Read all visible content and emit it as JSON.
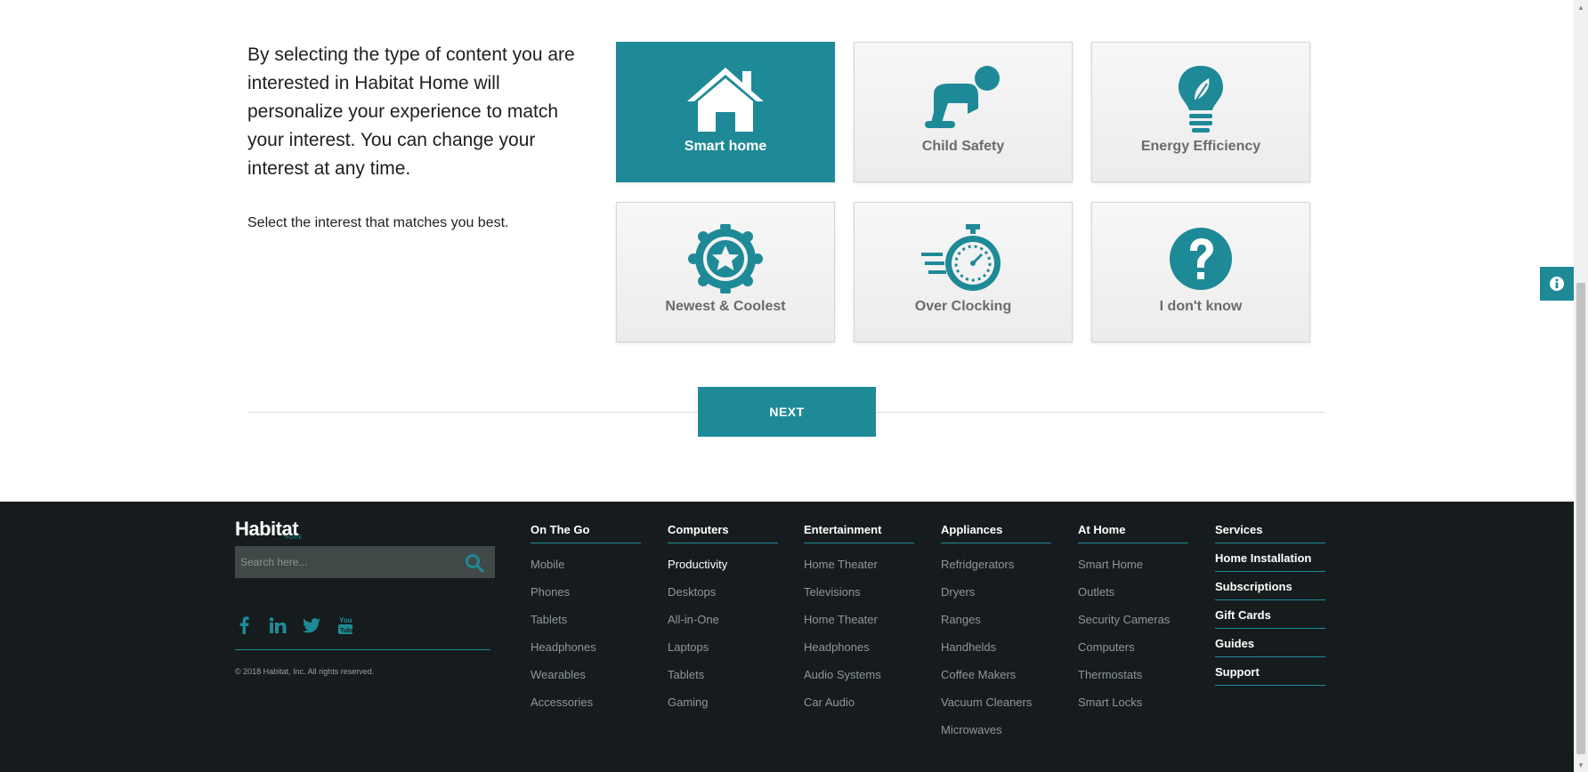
{
  "intro": {
    "text": "By selecting the type of content you are interested in Habitat Home will personalize your experience to match your interest. You can change your interest at any time.",
    "sub": "Select the interest that matches you best."
  },
  "tiles": [
    {
      "label": "Smart home",
      "icon": "house-icon",
      "selected": true
    },
    {
      "label": "Child Safety",
      "icon": "baby-crawling-icon",
      "selected": false
    },
    {
      "label": "Energy Efficiency",
      "icon": "lightbulb-leaf-icon",
      "selected": false
    },
    {
      "label": "Newest & Coolest",
      "icon": "star-badge-icon",
      "selected": false
    },
    {
      "label": "Over Clocking",
      "icon": "stopwatch-icon",
      "selected": false
    },
    {
      "label": "I don't know",
      "icon": "question-circle-icon",
      "selected": false
    }
  ],
  "next_label": "NEXT",
  "colors": {
    "accent": "#1f8a97",
    "footer_bg": "#161c1d"
  },
  "footer": {
    "brand": "Habitat",
    "brand_sub": "HOME",
    "search_placeholder": "Search here...",
    "copyright": "© 2018 Habitat, Inc. All rights reserved.",
    "columns": [
      {
        "title": "On The Go",
        "items": [
          "Mobile",
          "Phones",
          "Tablets",
          "Headphones",
          "Wearables",
          "Accessories"
        ]
      },
      {
        "title": "Computers",
        "items": [
          "Productivity",
          "Desktops",
          "All-in-One",
          "Laptops",
          "Tablets",
          "Gaming"
        ]
      },
      {
        "title": "Entertainment",
        "items": [
          "Home Theater",
          "Televisions",
          "Home Theater",
          "Headphones",
          "Audio Systems",
          "Car Audio"
        ]
      },
      {
        "title": "Appliances",
        "items": [
          "Refridgerators",
          "Dryers",
          "Ranges",
          "Handhelds",
          "Coffee Makers",
          "Vacuum Cleaners",
          "Microwaves"
        ]
      },
      {
        "title": "At Home",
        "items": [
          "Smart Home",
          "Outlets",
          "Security Cameras",
          "Computers",
          "Thermostats",
          "Smart Locks"
        ]
      }
    ],
    "services": {
      "title": "Services",
      "items": [
        "Home Installation",
        "Subscriptions",
        "Gift Cards",
        "Guides",
        "Support"
      ]
    }
  }
}
